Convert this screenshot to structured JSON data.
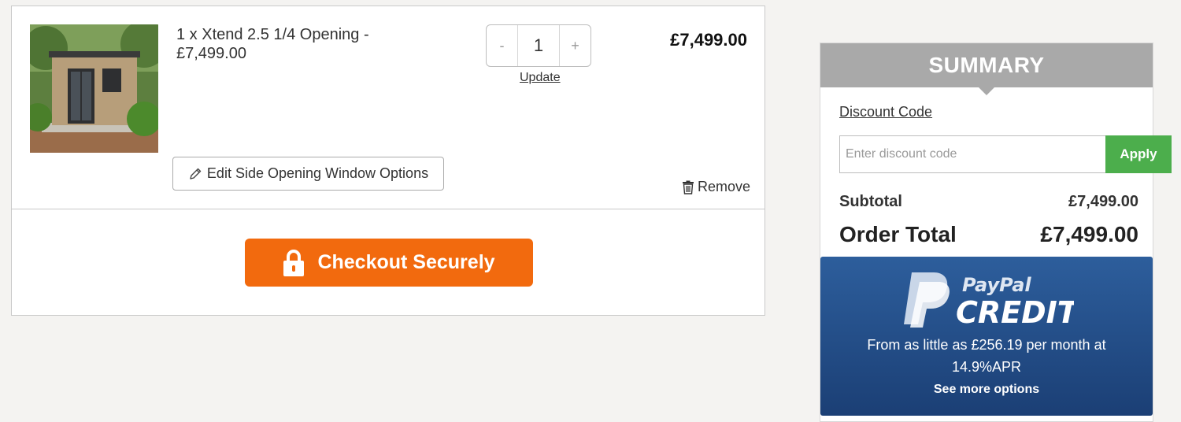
{
  "cart": {
    "item": {
      "image_alt": "Xtend garden room",
      "description": "1 x Xtend 2.5 1/4 Opening - £7,499.00",
      "quantity": "1",
      "qty_minus": "-",
      "qty_plus": "+",
      "update_label": "Update",
      "price": "£7,499.00",
      "edit_label": "Edit Side Opening Window Options",
      "remove_label": "Remove"
    },
    "checkout_label": "Checkout Securely"
  },
  "summary": {
    "title": "SUMMARY",
    "discount_label": "Discount Code",
    "discount_placeholder": "Enter discount code",
    "discount_value": "",
    "apply_label": "Apply",
    "subtotal_label": "Subtotal",
    "subtotal_value": "£7,499.00",
    "total_label": "Order Total",
    "total_value": "£7,499.00"
  },
  "paypal": {
    "brand_top": "PayPal",
    "brand_bottom": "CREDIT",
    "finance_text": "From as little as £256.19 per month at 14.9%APR",
    "more_label": "See more options"
  },
  "colors": {
    "checkout": "#f26a0e",
    "apply": "#4cae4c",
    "summary_header": "#a9a9a9",
    "paypal_bg": "#2d5e9c"
  }
}
